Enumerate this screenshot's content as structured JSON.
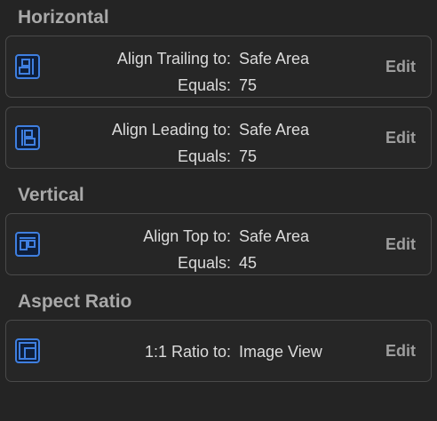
{
  "sections": [
    {
      "title": "Horizontal",
      "constraints": [
        {
          "icon": "align-trailing-icon",
          "label": "Align Trailing to:",
          "target": "Safe Area",
          "equals_label": "Equals:",
          "equals_value": "75",
          "action": "Edit"
        },
        {
          "icon": "align-leading-icon",
          "label": "Align Leading to:",
          "target": "Safe Area",
          "equals_label": "Equals:",
          "equals_value": "75",
          "action": "Edit"
        }
      ]
    },
    {
      "title": "Vertical",
      "constraints": [
        {
          "icon": "align-top-icon",
          "label": "Align Top to:",
          "target": "Safe Area",
          "equals_label": "Equals:",
          "equals_value": "45",
          "action": "Edit"
        }
      ]
    },
    {
      "title": "Aspect Ratio",
      "constraints": [
        {
          "icon": "aspect-ratio-icon",
          "label": "1:1 Ratio to:",
          "target": "Image View",
          "action": "Edit"
        }
      ]
    }
  ],
  "colors": {
    "background": "#242424",
    "icon_blue": "#3f7fe0",
    "card_border": "#4a4a4a",
    "section_title": "#a9a9a9"
  }
}
